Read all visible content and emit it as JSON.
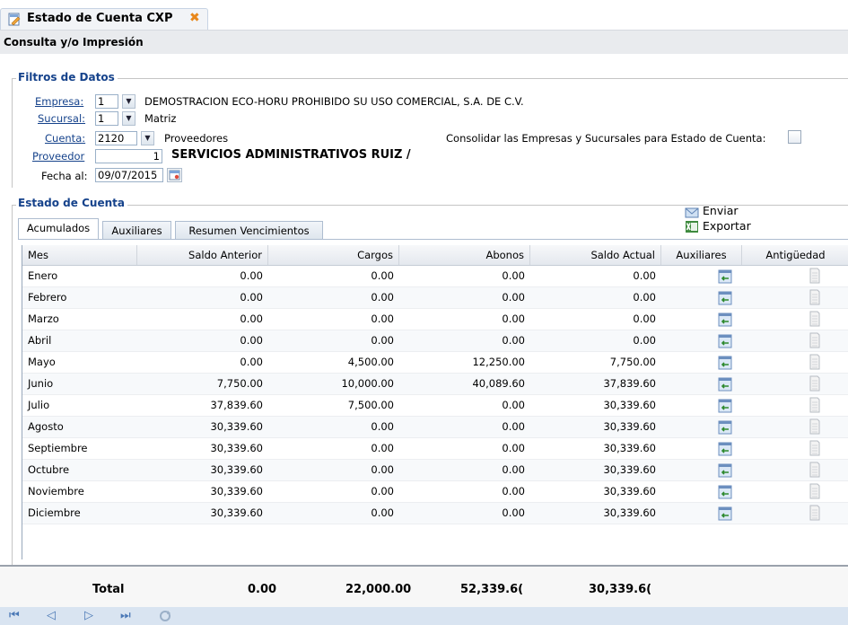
{
  "tab": {
    "title": "Estado de Cuenta CXP",
    "close": "✖"
  },
  "subtitle": "Consulta y/o Impresión",
  "filters": {
    "legend": "Filtros de Datos",
    "empresa": {
      "label": "Empresa:",
      "value": "1",
      "desc": "DEMOSTRACION ECO-HORU PROHIBIDO SU USO COMERCIAL, S.A. DE C.V."
    },
    "sucursal": {
      "label": "Sucursal:",
      "value": "1",
      "desc": "Matriz"
    },
    "cuenta": {
      "label": "Cuenta:",
      "value": "2120",
      "desc": "Proveedores"
    },
    "proveedor": {
      "label": "Proveedor",
      "value": "1",
      "desc": "SERVICIOS ADMINISTRATIVOS RUIZ /"
    },
    "fecha": {
      "label": "Fecha al:",
      "value": "09/07/2015"
    },
    "consolidar_label": "Consolidar las Empresas y Sucursales para Estado de Cuenta:"
  },
  "estado": {
    "legend": "Estado de Cuenta",
    "enviar": "Enviar",
    "exportar": "Exportar",
    "tabs": [
      "Acumulados",
      "Auxiliares",
      "Resumen Vencimientos"
    ]
  },
  "grid": {
    "columns": [
      "Mes",
      "Saldo Anterior",
      "Cargos",
      "Abonos",
      "Saldo Actual",
      "Auxiliares",
      "Antigüedad"
    ],
    "rows": [
      [
        "Enero",
        "0.00",
        "0.00",
        "0.00",
        "0.00"
      ],
      [
        "Febrero",
        "0.00",
        "0.00",
        "0.00",
        "0.00"
      ],
      [
        "Marzo",
        "0.00",
        "0.00",
        "0.00",
        "0.00"
      ],
      [
        "Abril",
        "0.00",
        "0.00",
        "0.00",
        "0.00"
      ],
      [
        "Mayo",
        "0.00",
        "4,500.00",
        "12,250.00",
        "7,750.00"
      ],
      [
        "Junio",
        "7,750.00",
        "10,000.00",
        "40,089.60",
        "37,839.60"
      ],
      [
        "Julio",
        "37,839.60",
        "7,500.00",
        "0.00",
        "30,339.60"
      ],
      [
        "Agosto",
        "30,339.60",
        "0.00",
        "0.00",
        "30,339.60"
      ],
      [
        "Septiembre",
        "30,339.60",
        "0.00",
        "0.00",
        "30,339.60"
      ],
      [
        "Octubre",
        "30,339.60",
        "0.00",
        "0.00",
        "30,339.60"
      ],
      [
        "Noviembre",
        "30,339.60",
        "0.00",
        "0.00",
        "30,339.60"
      ],
      [
        "Diciembre",
        "30,339.60",
        "0.00",
        "0.00",
        "30,339.60"
      ]
    ]
  },
  "totals": {
    "label": "Total",
    "saldo_anterior": "0.00",
    "cargos": "22,000.00",
    "abonos": "52,339.6(",
    "saldo_actual": "30,339.6("
  },
  "pager": {
    "first": "⏮",
    "prev": "◁",
    "next": "▷",
    "last": "⏭"
  },
  "colors": {
    "link": "#15428b",
    "accent": "#e8871a",
    "pager_bg": "#d9e4f1"
  }
}
